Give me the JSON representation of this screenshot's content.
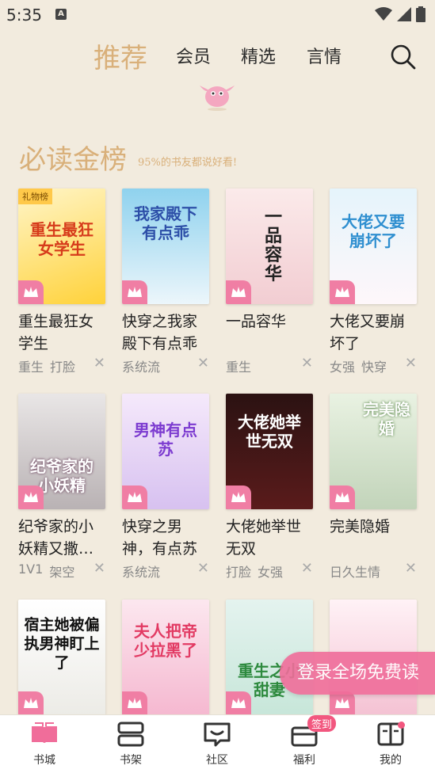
{
  "status": {
    "time": "5:35",
    "notif_icon": "A"
  },
  "nav": {
    "tabs": [
      {
        "label": "推荐",
        "active": true
      },
      {
        "label": "会员",
        "active": false
      },
      {
        "label": "精选",
        "active": false
      },
      {
        "label": "言情",
        "active": false
      }
    ],
    "search_icon": "search-icon"
  },
  "section": {
    "title": "必读金榜",
    "subtitle": "95%的书友都说好看!"
  },
  "books": [
    {
      "title": "重生最狂女学生",
      "cover_text": "重生最狂女学生",
      "tags": [
        "重生",
        "打脸"
      ]
    },
    {
      "title": "快穿之我家殿下有点乖",
      "cover_text": "我家殿下有点乖",
      "tags": [
        "系统流"
      ]
    },
    {
      "title": "一品容华",
      "cover_text": "一品容华",
      "tags": [
        "重生"
      ]
    },
    {
      "title": "大佬又要崩坏了",
      "cover_text": "大佬又要崩坏了",
      "tags": [
        "女强",
        "快穿"
      ]
    },
    {
      "title": "纪爷家的小妖精又撒…",
      "cover_text": "纪爷家的小妖精",
      "tags": [
        "1V1",
        "架空"
      ]
    },
    {
      "title": "快穿之男神，有点苏",
      "cover_text": "男神有点苏",
      "tags": [
        "系统流"
      ]
    },
    {
      "title": "大佬她举世无双",
      "cover_text": "大佬她举世无双",
      "tags": [
        "打脸",
        "女强"
      ]
    },
    {
      "title": "完美隐婚",
      "cover_text": "完美隐婚",
      "tags": [
        "日久生情"
      ]
    },
    {
      "title": "",
      "cover_text": "宿主她被偏执男神盯上了",
      "tags": []
    },
    {
      "title": "",
      "cover_text": "夫人把帝少拉黑了",
      "tags": []
    },
    {
      "title": "",
      "cover_text": "重生之小甜妻",
      "tags": []
    },
    {
      "title": "",
      "cover_text": "",
      "tags": []
    }
  ],
  "cover_badge": "礼物榜",
  "float_banner": "登录全场免费读",
  "bottom_nav": [
    {
      "label": "书城",
      "icon": "book-open-icon",
      "active": true
    },
    {
      "label": "书架",
      "icon": "bookshelf-icon",
      "active": false
    },
    {
      "label": "社区",
      "icon": "chat-bubble-icon",
      "active": false
    },
    {
      "label": "福利",
      "icon": "gift-box-icon",
      "badge": "签到",
      "active": false
    },
    {
      "label": "我的",
      "icon": "profile-book-icon",
      "active": false
    }
  ],
  "colors": {
    "accent": "#d9b07a",
    "pink": "#f06d9a",
    "background": "#f2ebde"
  }
}
